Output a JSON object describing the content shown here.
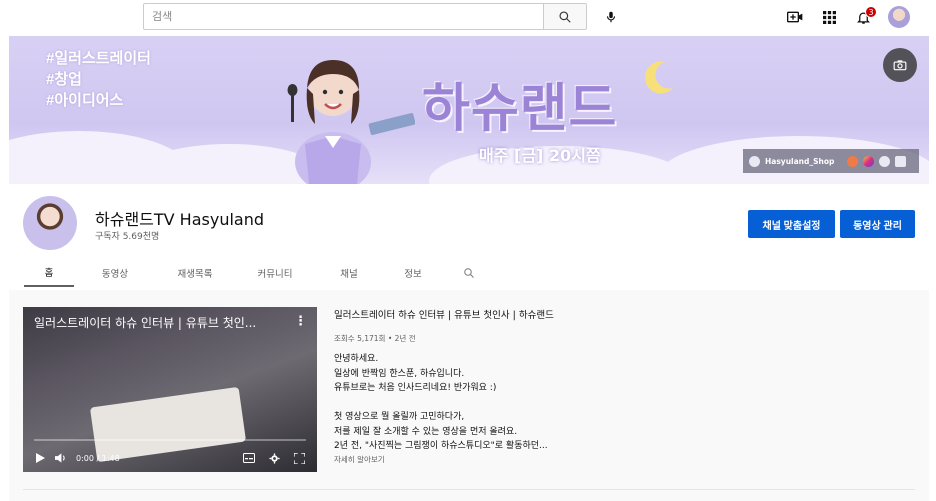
{
  "topbar": {
    "search_placeholder": "검색",
    "notification_count": "3"
  },
  "banner": {
    "hashtags": [
      "#일러스트레이터",
      "#창업",
      "#아이디어스"
    ],
    "brand_title": "하슈랜드",
    "schedule": "매주 [금] 20시쯤",
    "shop_link": "Hasyuland_Shop",
    "colors": {
      "bg": "#d6cdf3",
      "brand": "#9b84d6"
    }
  },
  "channel": {
    "name": "하슈랜드TV Hasyuland",
    "subscribers": "구독자 5.69천명",
    "customize_label": "채널 맞춤설정",
    "manage_label": "동영상 관리",
    "accent": "#065fd4"
  },
  "tabs": [
    {
      "label": "홈",
      "active": true
    },
    {
      "label": "동영상",
      "active": false
    },
    {
      "label": "재생목록",
      "active": false
    },
    {
      "label": "커뮤니티",
      "active": false
    },
    {
      "label": "채널",
      "active": false
    },
    {
      "label": "정보",
      "active": false
    }
  ],
  "featured": {
    "player_title": "일러스트레이터 하슈 인터뷰 | 유튜브 첫인...",
    "time": "0:00 / 1:48",
    "progress": 0,
    "title": "일러스트레이터 하슈 인터뷰 | 유튜브 첫인사 | 하슈랜드",
    "meta": "조회수 5,171회 • 2년 전",
    "description": [
      "안녕하세요.",
      "일상에 반짝임 한스푼, 하슈입니다.",
      "유튜브로는 처음 인사드리네요! 반가워요 :)",
      "",
      "첫 영상으로 뭘 올릴까 고민하다가,",
      "저를 제일 잘 소개할 수 있는 영상을 먼저 올려요.",
      "2년 전, \"사진찍는 그림쟁이 하슈스튜디오\"로 활동하던..."
    ],
    "more_label": "자세히 알아보기"
  }
}
